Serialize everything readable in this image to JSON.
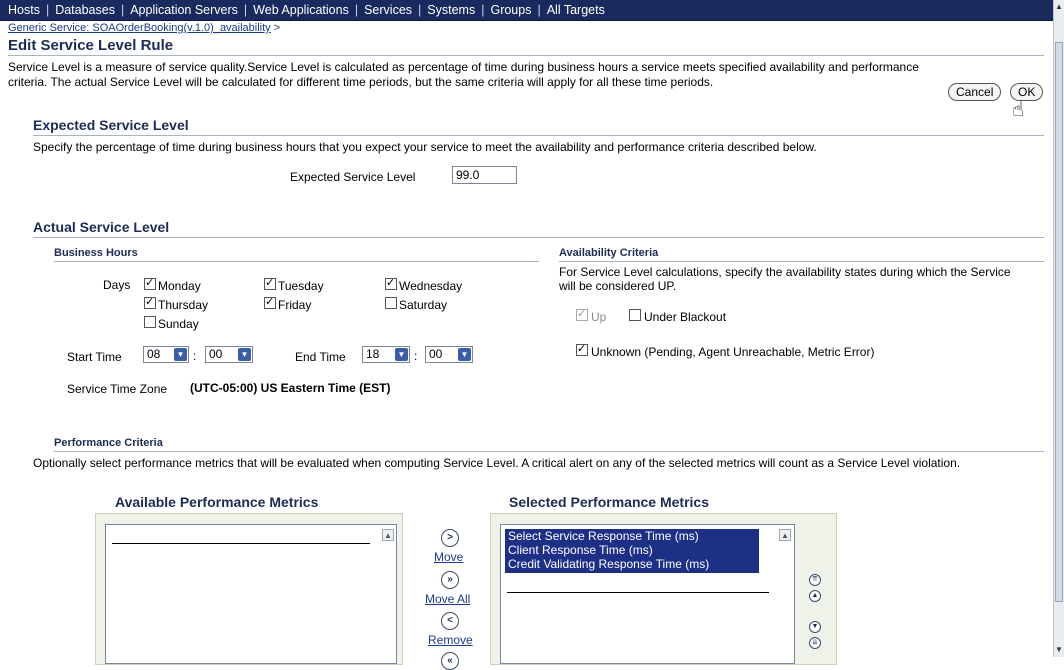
{
  "nav": {
    "items": [
      "Hosts",
      "Databases",
      "Application Servers",
      "Web Applications",
      "Services",
      "Systems",
      "Groups",
      "All Targets"
    ]
  },
  "breadcrumb": {
    "link": "Generic Service: SOAOrderBooking(v.1.0)_availability",
    "sep": ">"
  },
  "page": {
    "title": "Edit Service Level Rule",
    "description": "Service Level is a measure of service quality.Service Level is calculated as percentage of time during business hours a service meets specified availability and performance criteria. The actual Service Level will be calculated for different time periods, but the same criteria will apply for all these time periods."
  },
  "buttons": {
    "cancel": "Cancel",
    "ok": "OK"
  },
  "expected": {
    "title": "Expected Service Level",
    "description": "Specify the percentage of time during business hours that you expect your service to meet the availability and performance criteria described below.",
    "label": "Expected Service Level",
    "value": "99.0"
  },
  "actual": {
    "title": "Actual Service Level",
    "business_hours": {
      "title": "Business Hours",
      "days_label": "Days",
      "days": [
        {
          "label": "Monday",
          "checked": true
        },
        {
          "label": "Tuesday",
          "checked": true
        },
        {
          "label": "Wednesday",
          "checked": true
        },
        {
          "label": "Thursday",
          "checked": true
        },
        {
          "label": "Friday",
          "checked": true
        },
        {
          "label": "Saturday",
          "checked": false
        },
        {
          "label": "Sunday",
          "checked": false
        }
      ],
      "start_label": "Start Time",
      "start_hour": "08",
      "start_min": "00",
      "end_label": "End Time",
      "end_hour": "18",
      "end_min": "00",
      "colon": ":",
      "tz_label": "Service Time Zone",
      "tz_value": "(UTC-05:00) US Eastern Time (EST)"
    },
    "availability": {
      "title": "Availability Criteria",
      "description": "For Service Level calculations, specify the availability states during which the Service will be considered UP.",
      "up": {
        "label": "Up",
        "checked": true,
        "disabled": true
      },
      "blackout": {
        "label": "Under Blackout",
        "checked": false
      },
      "unknown": {
        "label": "Unknown (Pending, Agent Unreachable, Metric Error)",
        "checked": true
      }
    }
  },
  "performance": {
    "title": "Performance Criteria",
    "description": "Optionally select performance metrics that will be evaluated when computing Service Level. A critical alert on any of the selected metrics will count as a Service Level violation.",
    "available_title": "Available Performance Metrics",
    "selected_title": "Selected Performance Metrics",
    "selected_items": [
      "Select Service Response Time (ms)",
      "Client Response Time (ms)",
      "Credit Validating Response Time (ms)"
    ],
    "move": "Move",
    "move_all": "Move All",
    "remove": "Remove"
  }
}
